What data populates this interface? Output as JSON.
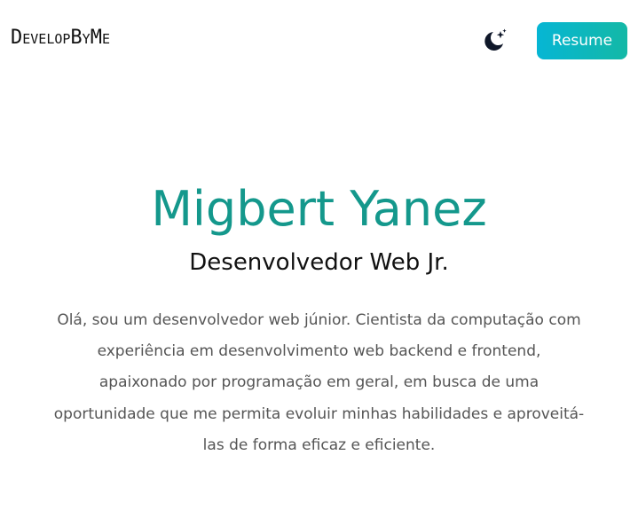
{
  "header": {
    "logo_text": "DevelopByMe",
    "theme_toggle_icon": "moon-stars-icon",
    "resume_label": "Resume"
  },
  "hero": {
    "name": "Migbert Yanez",
    "role": "Desenvolvedor Web Jr.",
    "bio": "Olá, sou um desenvolvedor web júnior. Cientista da computação com experiência em desenvolvimento web backend e frontend, apaixonado por programação em geral, em busca de uma oportunidade que me permita evoluir minhas habilidades e aproveitá-las de forma eficaz e eficiente."
  },
  "colors": {
    "accent": "#14988c",
    "button_gradient_start": "#06b6d4",
    "button_gradient_end": "#14b8a6",
    "text_dark": "#111111",
    "text_muted": "#555555"
  }
}
